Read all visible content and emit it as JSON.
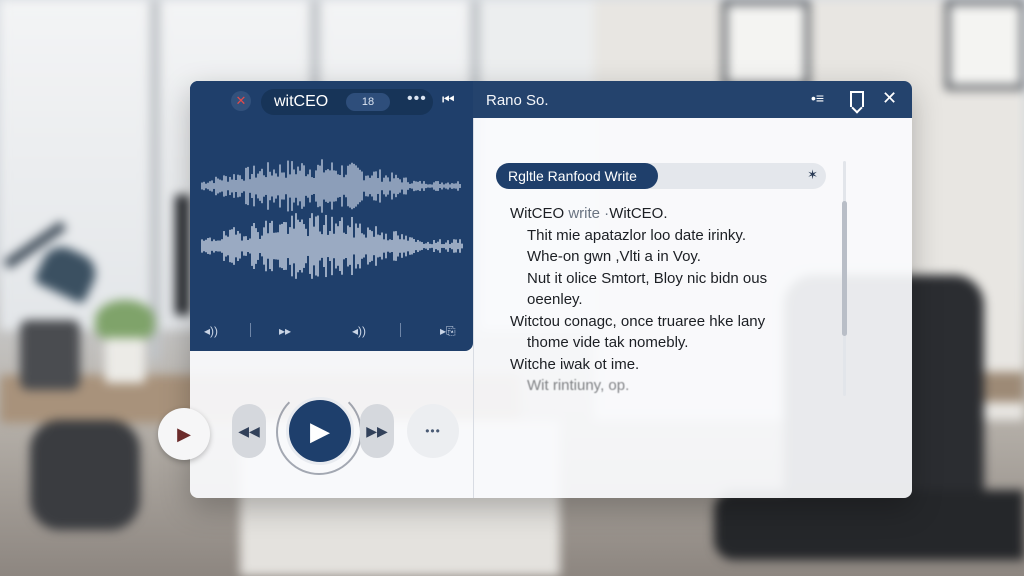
{
  "window": {
    "app_name": "witCEO",
    "tab_badge": "18",
    "tab_more": "•••",
    "close_icon": "✕",
    "skip_icon": "⏮",
    "document_title": "Rano So.",
    "menu_icon": "•≡",
    "close_window_icon": "✕"
  },
  "waveform": {
    "controls": [
      "◂))",
      "▸▸",
      "◂))",
      "▸⎘"
    ]
  },
  "player": {
    "play_small": "▶",
    "rewind": "◀◀",
    "play": "▶",
    "fast_forward": "▶▶",
    "more": "•••"
  },
  "transcript": {
    "tab_label": "Rgltle Ranfood Write",
    "tab_pin": "✶",
    "lines": [
      {
        "lead": "WitCEO ",
        "muted": "write ·",
        "rest": "WitCEO."
      },
      {
        "text": "Thit mie apatazlor loo date irinky."
      },
      {
        "text": "Whe-on gwn ,Vlti a in Voy."
      },
      {
        "text": "Nut it olice Smtort, Bloy nic bidn ous"
      },
      {
        "text": "oeenley."
      },
      {
        "text": "Witctou conagc, once truaree hke lany"
      },
      {
        "text": "thome vide tak nomebly."
      },
      {
        "text": "Witche iwak ot ime."
      },
      {
        "text": "Wit rintiuny, op."
      }
    ]
  },
  "colors": {
    "primary": "#1f3f6b",
    "titlebar": "#24436d",
    "accent_red": "#e24b4b"
  }
}
